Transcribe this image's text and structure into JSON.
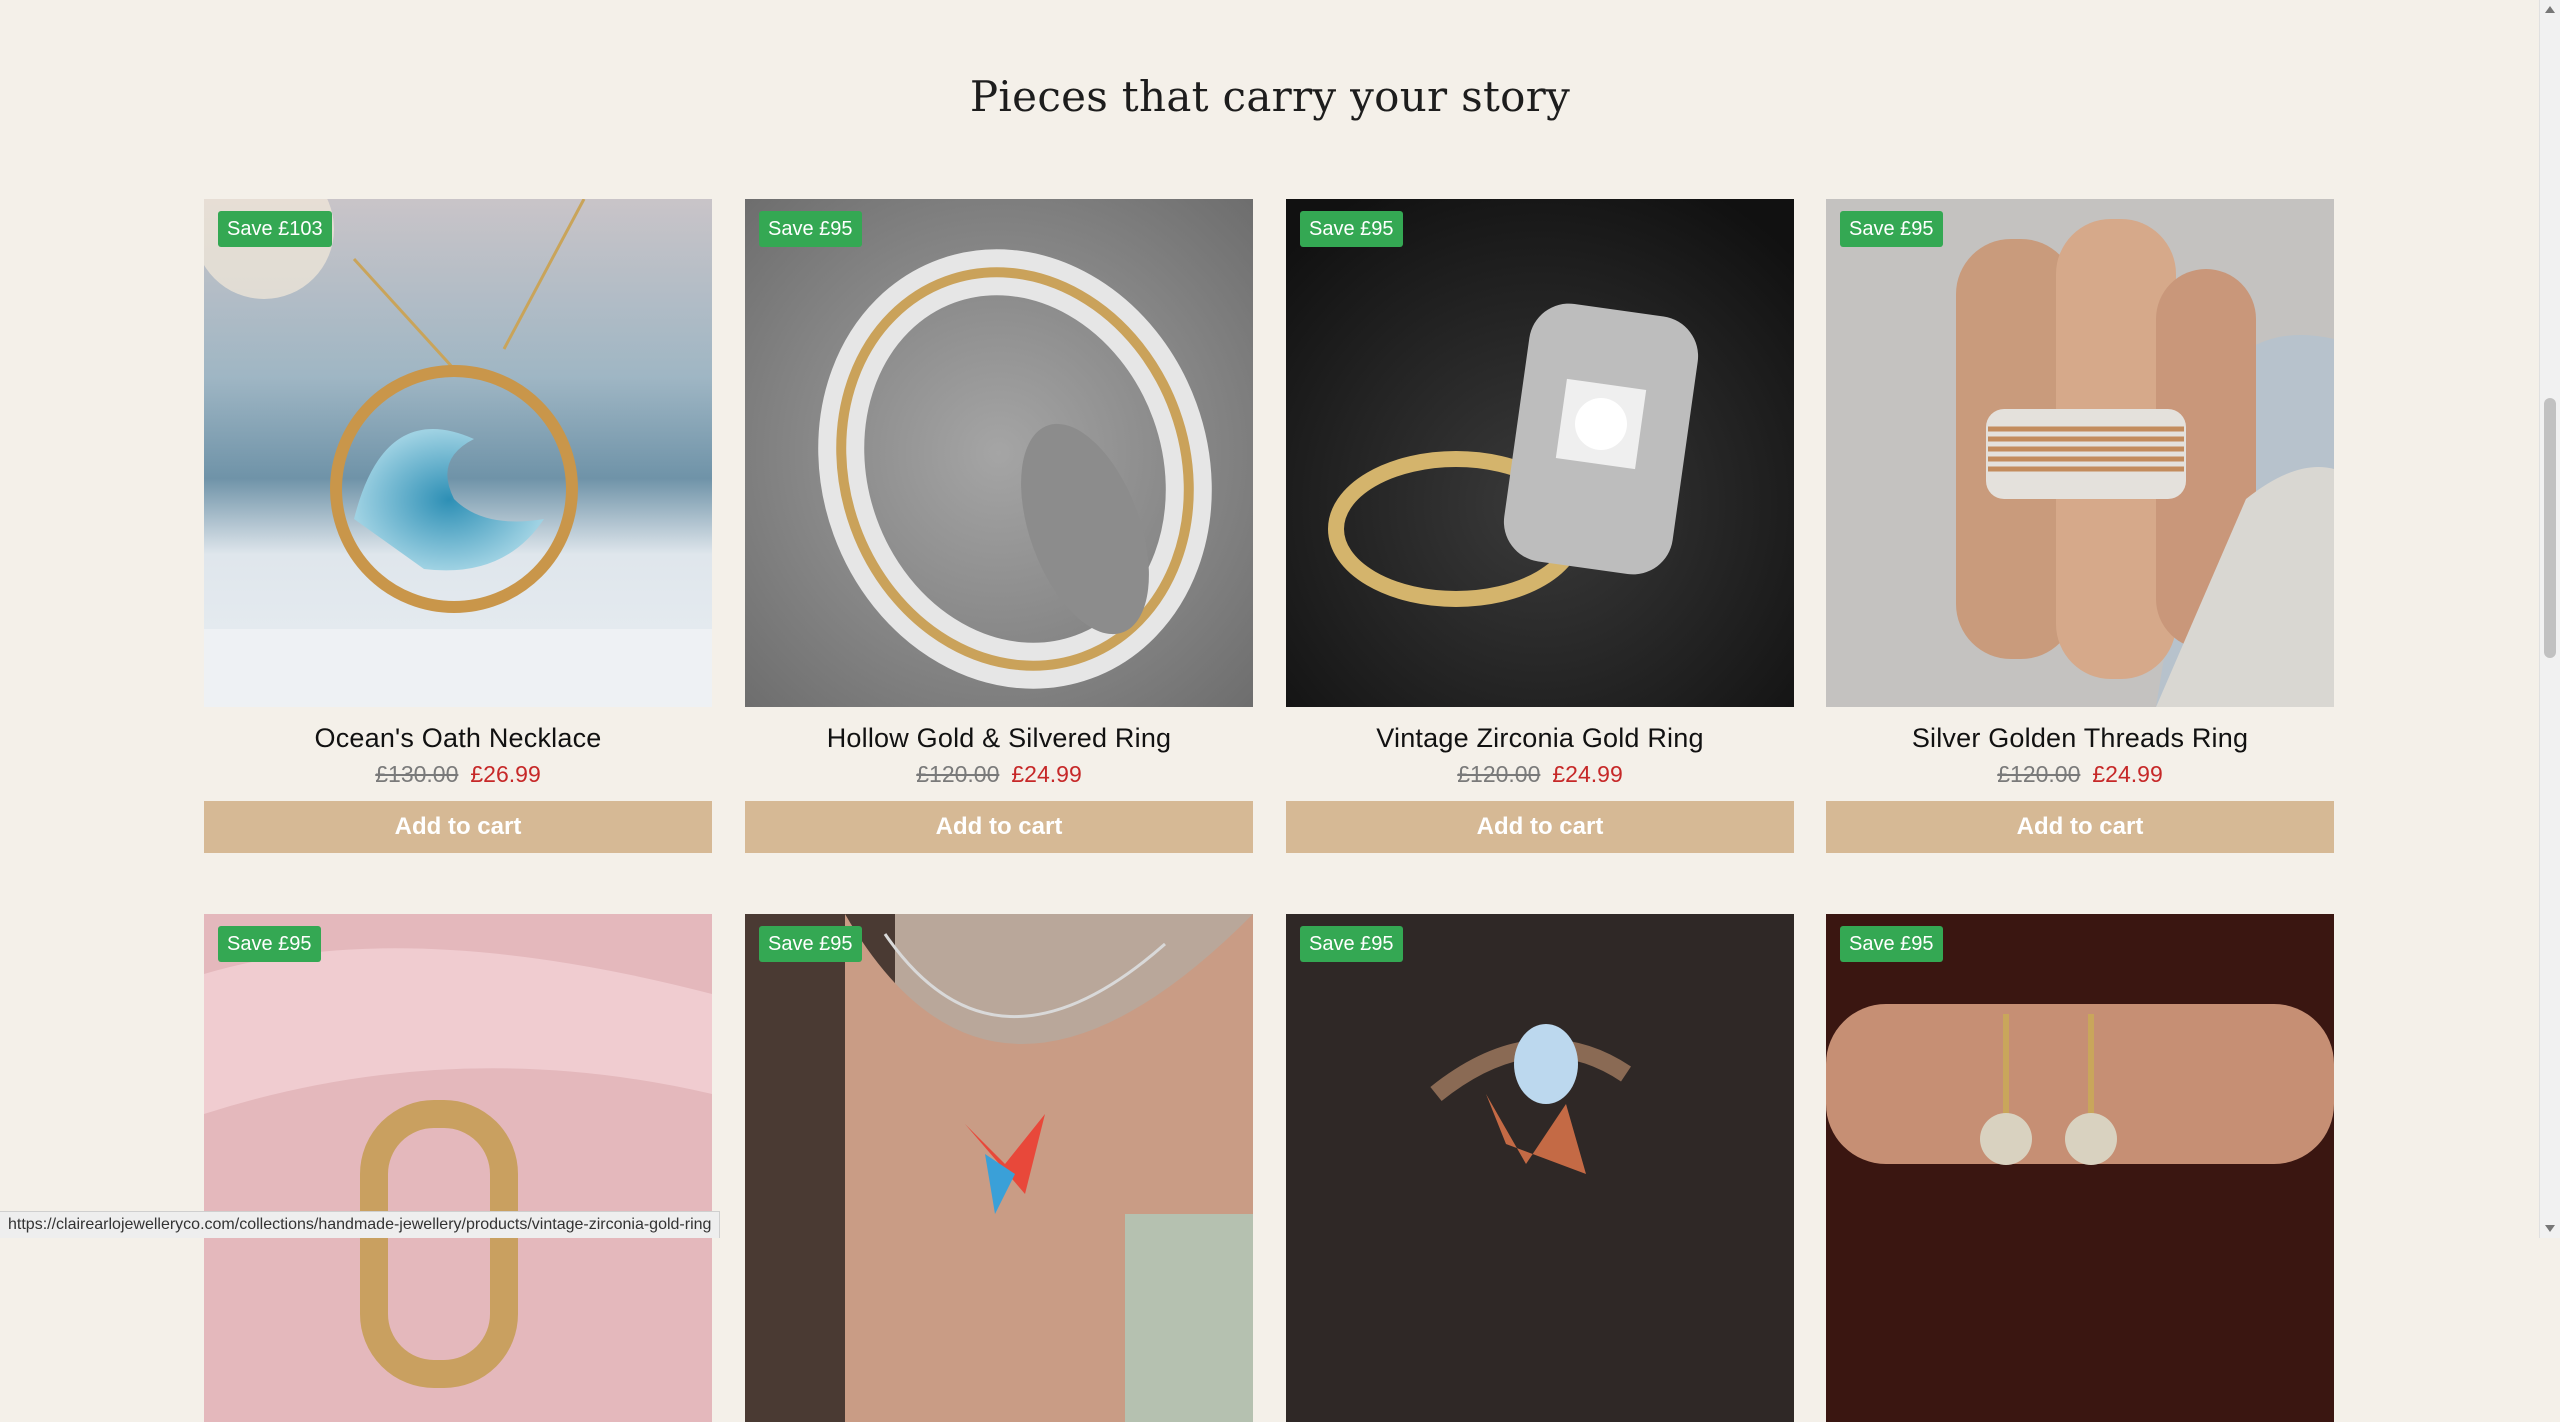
{
  "section": {
    "heading": "Pieces that carry your story"
  },
  "products": [
    {
      "badge": "Save £103",
      "title": "Ocean's Oath Necklace",
      "old_price": "£130.00",
      "new_price": "£26.99",
      "button": "Add to cart",
      "image": "wave-necklace"
    },
    {
      "badge": "Save £95",
      "title": "Hollow Gold & Silvered Ring",
      "old_price": "£120.00",
      "new_price": "£24.99",
      "button": "Add to cart",
      "image": "filigree-ring"
    },
    {
      "badge": "Save £95",
      "title": "Vintage Zirconia Gold Ring",
      "old_price": "£120.00",
      "new_price": "£24.99",
      "button": "Add to cart",
      "image": "vintage-ring"
    },
    {
      "badge": "Save £95",
      "title": "Silver Golden Threads Ring",
      "old_price": "£120.00",
      "new_price": "£24.99",
      "button": "Add to cart",
      "image": "threads-ring"
    },
    {
      "badge": "Save £95",
      "image": "gold-band-ring"
    },
    {
      "badge": "Save £95",
      "image": "hummingbird-necklace"
    },
    {
      "badge": "Save £95",
      "image": "leaf-moonstone-ring"
    },
    {
      "badge": "Save £95",
      "image": "pearl-earrings"
    }
  ],
  "status_bar": {
    "url": "https://clairearlojewelleryco.com/collections/handmade-jewellery/products/vintage-zirconia-gold-ring"
  }
}
